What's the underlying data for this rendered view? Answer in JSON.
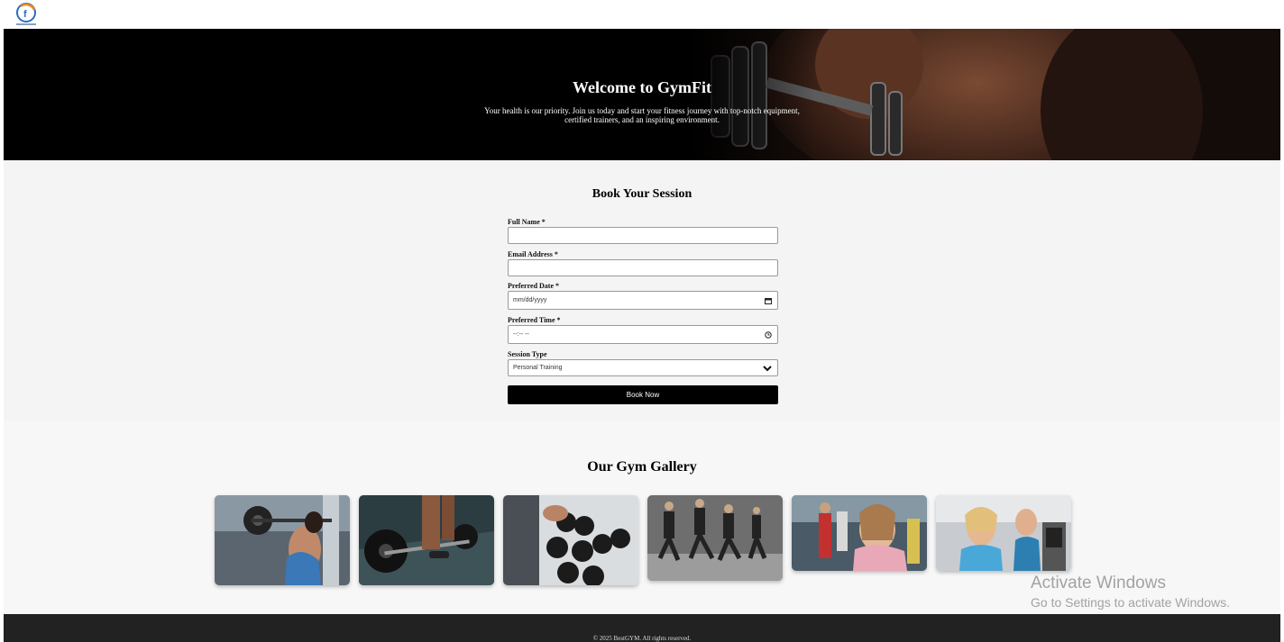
{
  "logo": {
    "icon": "gym-logo-icon",
    "caption": "BestGYM"
  },
  "hero": {
    "title": "Welcome to GymFit",
    "subtitle": "Your health is our priority. Join us today and start your fitness journey with top-notch equipment, certified trainers, and an inspiring environment."
  },
  "booking": {
    "title": "Book Your Session",
    "full_name_label": "Full Name *",
    "full_name_value": "",
    "email_label": "Email Address *",
    "email_value": "",
    "date_label": "Preferred Date *",
    "date_placeholder": "mm/dd/yyyy",
    "time_label": "Preferred Time *",
    "time_placeholder": "--:-- --",
    "session_label": "Session Type",
    "session_value": "Personal Training",
    "submit_label": "Book Now"
  },
  "gallery": {
    "title": "Our Gym Gallery",
    "images": [
      "woman-squat-barbell",
      "man-deadlift-barbell",
      "man-dumbbell-rack",
      "group-lunge-class",
      "women-cardio-class",
      "women-treadmill"
    ]
  },
  "footer": {
    "copyright": "© 2025 BestGYM. All rights reserved."
  },
  "watermark": {
    "line1": "Activate Windows",
    "line2": "Go to Settings to activate Windows."
  }
}
